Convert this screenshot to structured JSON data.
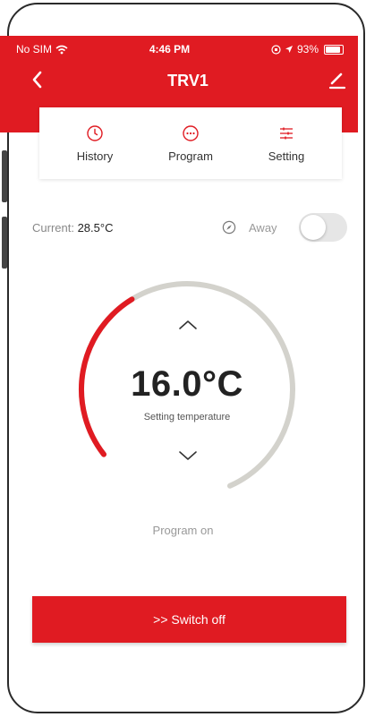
{
  "status_bar": {
    "carrier": "No SIM",
    "time": "4:46 PM",
    "battery": "93%"
  },
  "header": {
    "title": "TRV1",
    "back_icon": "chevron-left-icon",
    "edit_icon": "pencil-icon"
  },
  "tabs": [
    {
      "label": "History",
      "icon": "clock-icon"
    },
    {
      "label": "Program",
      "icon": "dots-circle-icon"
    },
    {
      "label": "Setting",
      "icon": "sliders-icon"
    }
  ],
  "current": {
    "label": "Current: ",
    "value": "28.5°C"
  },
  "away": {
    "label": "Away",
    "enabled": false
  },
  "dial": {
    "temperature": "16.0°C",
    "label": "Setting temperature",
    "level_fraction": 0.34
  },
  "program_status": "Program on",
  "switch_button": ">>  Switch off",
  "colors": {
    "accent": "#e01b22",
    "track": "#d3d2cc"
  }
}
